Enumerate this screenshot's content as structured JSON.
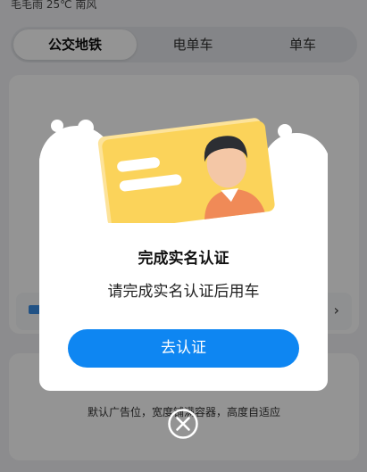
{
  "status": {
    "weather": "毛毛雨 25℃ 南风"
  },
  "tabs": [
    {
      "label": "公交地铁",
      "active": true
    },
    {
      "label": "电单车",
      "active": false
    },
    {
      "label": "单车",
      "active": false
    }
  ],
  "ad": {
    "placeholder": "默认广告位，宽度铺满容器，高度自适应"
  },
  "modal": {
    "title": "完成实名认证",
    "description": "请完成实名认证后用车",
    "button_label": "去认证"
  },
  "colors": {
    "accent": "#0e86f2",
    "card_yellow": "#fbd35a"
  },
  "icons": {
    "close": "close-circle-icon",
    "card": "id-card-illustration",
    "chevron": "chevron-right-icon"
  }
}
